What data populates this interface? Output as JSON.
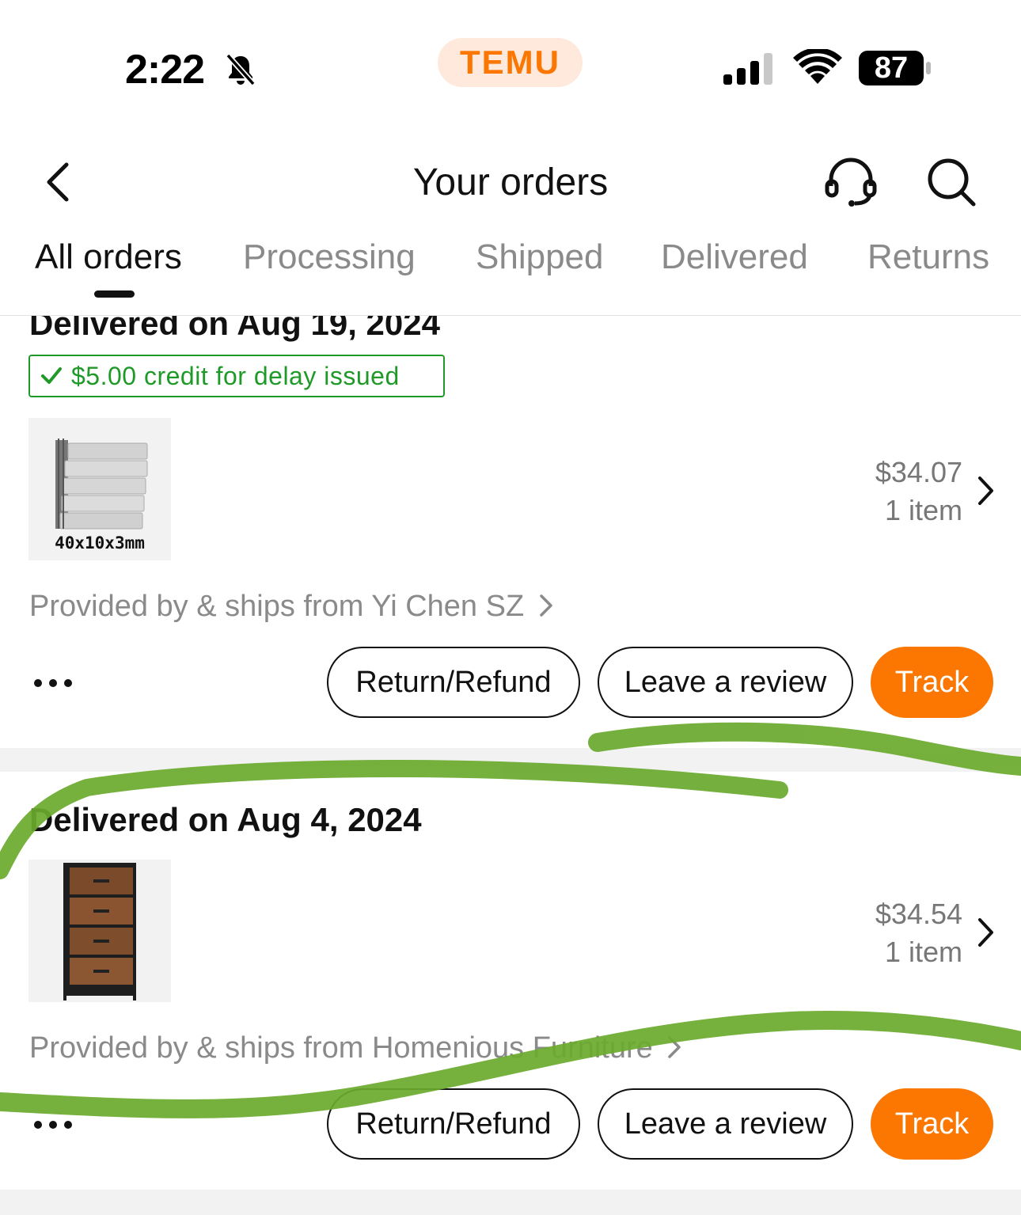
{
  "status_bar": {
    "time": "2:22",
    "app_name": "TEMU",
    "battery": "87"
  },
  "header": {
    "title": "Your orders"
  },
  "tabs": [
    {
      "label": "All orders",
      "active": true
    },
    {
      "label": "Processing",
      "active": false
    },
    {
      "label": "Shipped",
      "active": false
    },
    {
      "label": "Delivered",
      "active": false
    },
    {
      "label": "Returns",
      "active": false
    }
  ],
  "orders": [
    {
      "status": "Delivered on Aug 19, 2024",
      "credit_badge": "$5.00 credit for delay issued",
      "thumb_label": "40x10x3mm",
      "price": "$34.07",
      "item_count": "1 item",
      "seller": "Provided by & ships from Yi Chen SZ",
      "actions": {
        "return": "Return/Refund",
        "review": "Leave a review",
        "track": "Track"
      }
    },
    {
      "status": "Delivered on Aug 4, 2024",
      "price": "$34.54",
      "item_count": "1 item",
      "seller": "Provided by & ships from Homenious Furniture",
      "actions": {
        "return": "Return/Refund",
        "review": "Leave a review",
        "track": "Track"
      }
    }
  ],
  "colors": {
    "accent": "#fb7701",
    "accent_bg": "#ffe9dc",
    "credit_green": "#1f9a28",
    "scribble_green": "#6aaa2e"
  },
  "icons": [
    "bell-slash-icon",
    "signal-icon",
    "wifi-icon",
    "battery-icon",
    "back-chevron-icon",
    "headset-icon",
    "search-icon",
    "checkmark-icon",
    "chevron-right-icon",
    "more-dots-icon"
  ]
}
